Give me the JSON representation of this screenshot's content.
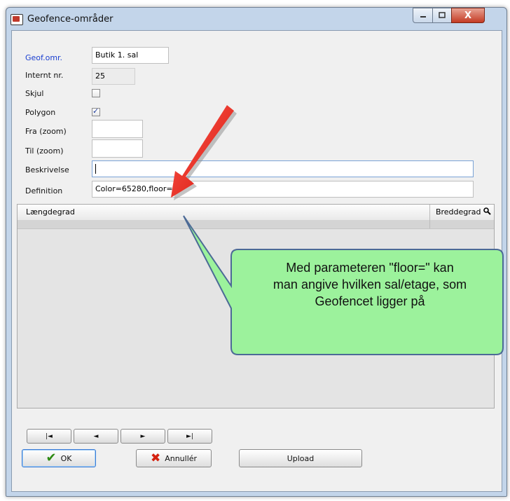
{
  "window": {
    "title": "Geofence-områder",
    "close_glyph": "X"
  },
  "form": {
    "geof_label": "Geof.omr.",
    "geof_value": "Butik 1. sal",
    "internt_label": "Internt nr.",
    "internt_value": "25",
    "skjul_label": "Skjul",
    "skjul_checked": false,
    "polygon_label": "Polygon",
    "polygon_checked": true,
    "fra_label": "Fra (zoom)",
    "fra_value": "",
    "til_label": "Til (zoom)",
    "til_value": "",
    "beskrivelse_label": "Beskrivelse",
    "beskrivelse_value": "",
    "definition_label": "Definition",
    "definition_value": "Color=65280,floor=1"
  },
  "grid": {
    "col_laengdegrad": "Længdegrad",
    "col_breddegrad": "Breddegrad"
  },
  "nav": {
    "first": "|◄",
    "prev": "◄",
    "next": "►",
    "last": "►|"
  },
  "buttons": {
    "ok": "OK",
    "annuller": "Annullér",
    "upload": "Upload"
  },
  "callout": {
    "lines": [
      "Med parameteren \"floor=\" kan",
      "man angive hvilken sal/etage, som",
      "Geofencet ligger på"
    ],
    "fill": "#9cf29c",
    "arrow_color": "#e8231c"
  }
}
